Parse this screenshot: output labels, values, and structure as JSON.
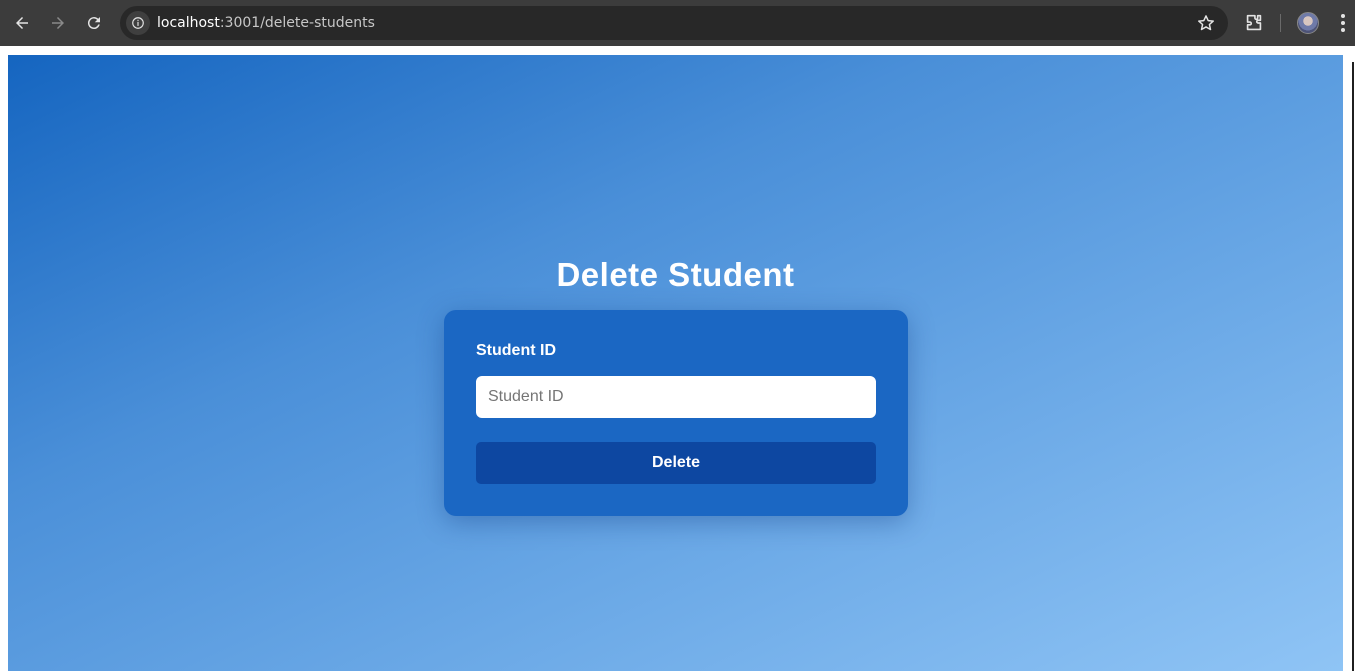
{
  "browser": {
    "url_host": "localhost",
    "url_path": ":3001/delete-students"
  },
  "page": {
    "title": "Delete Student",
    "form": {
      "label": "Student ID",
      "input_value": "",
      "input_placeholder": "Student ID",
      "submit_label": "Delete"
    }
  },
  "icons": {
    "back": "arrow-left-icon",
    "forward": "arrow-right-icon",
    "reload": "reload-icon",
    "site_info": "info-icon",
    "bookmark": "star-icon",
    "extensions": "puzzle-icon",
    "profile": "avatar",
    "menu": "kebab-menu-icon"
  },
  "colors": {
    "card": "#1b67c3",
    "button": "#0d47a1",
    "gradient_start": "#1565c0",
    "gradient_end": "#8fc4f5"
  }
}
